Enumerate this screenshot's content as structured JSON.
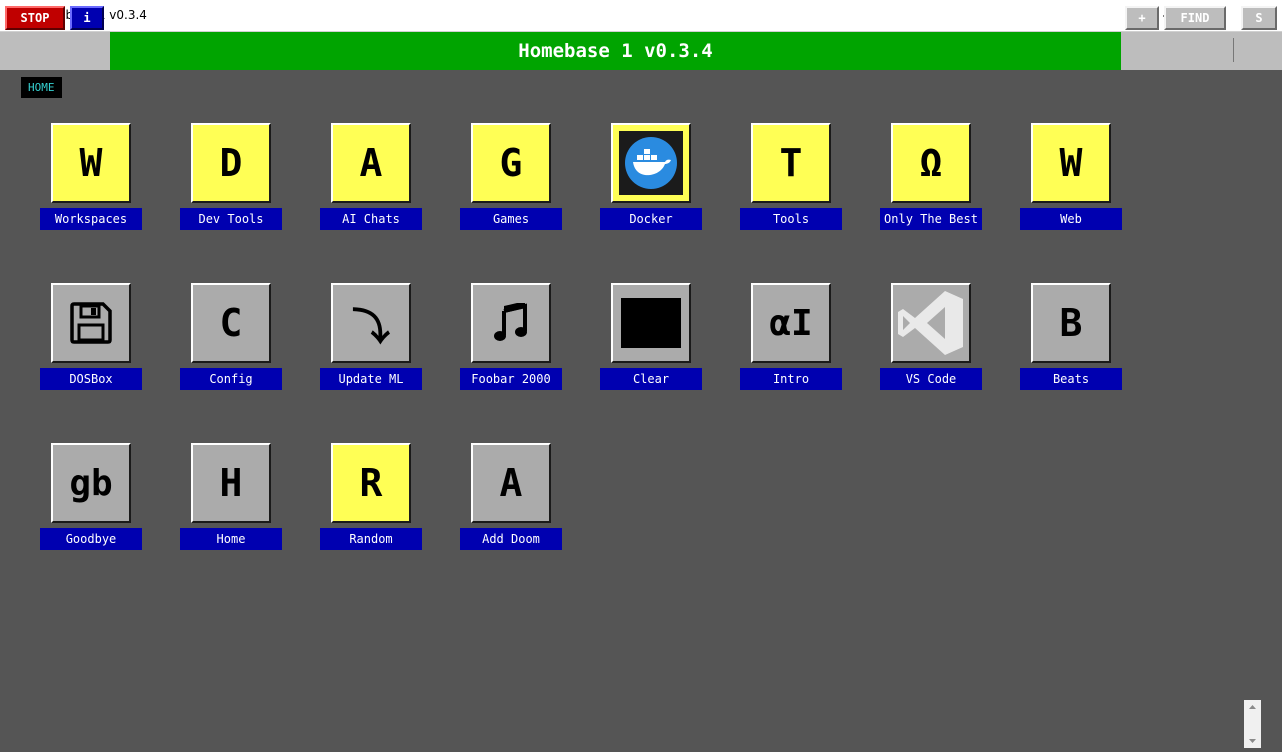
{
  "window": {
    "title": "Homebase 1 v0.3.4"
  },
  "toolbar": {
    "stop_label": "STOP",
    "info_label": "i",
    "banner": "Homebase 1 v0.3.4",
    "add_label": "+",
    "find_label": "FIND",
    "s_label": "S"
  },
  "breadcrumb": "HOME",
  "colors": {
    "toolbar_green": "#00a400",
    "label_blue": "#0000b0",
    "tile_yellow": "#ffff55",
    "tile_grey": "#ababab",
    "background": "#555555",
    "stop_red": "#c00000",
    "crumb_text": "#35d0d0"
  },
  "tiles": [
    {
      "label": "Workspaces",
      "glyph": "W",
      "color": "yellow"
    },
    {
      "label": "Dev Tools",
      "glyph": "D",
      "color": "yellow"
    },
    {
      "label": "AI Chats",
      "glyph": "A",
      "color": "yellow"
    },
    {
      "label": "Games",
      "glyph": "G",
      "color": "yellow"
    },
    {
      "label": "Docker",
      "icon": "docker-whale-icon",
      "color": "yellow"
    },
    {
      "label": "Tools",
      "glyph": "T",
      "color": "yellow"
    },
    {
      "label": "Only The Best",
      "glyph": "Ω",
      "color": "yellow"
    },
    {
      "label": "Web",
      "glyph": "W",
      "color": "yellow"
    },
    {
      "label": "DOSBox",
      "icon": "floppy-disk-icon",
      "color": "grey"
    },
    {
      "label": "Config",
      "glyph": "C",
      "color": "grey"
    },
    {
      "label": "Update ML",
      "glyph": "⤵",
      "color": "grey"
    },
    {
      "label": "Foobar 2000",
      "icon": "music-note-icon",
      "color": "grey"
    },
    {
      "label": "Clear",
      "icon": "black-square-icon",
      "color": "grey"
    },
    {
      "label": "Intro",
      "glyph": "αI",
      "color": "grey"
    },
    {
      "label": "VS Code",
      "icon": "vscode-icon",
      "color": "grey"
    },
    {
      "label": "Beats",
      "glyph": "B",
      "color": "grey"
    },
    {
      "label": "Goodbye",
      "glyph": "gb",
      "color": "grey"
    },
    {
      "label": "Home",
      "glyph": "H",
      "color": "grey"
    },
    {
      "label": "Random",
      "glyph": "R",
      "color": "yellow"
    },
    {
      "label": "Add Doom",
      "glyph": "A",
      "color": "grey"
    }
  ]
}
